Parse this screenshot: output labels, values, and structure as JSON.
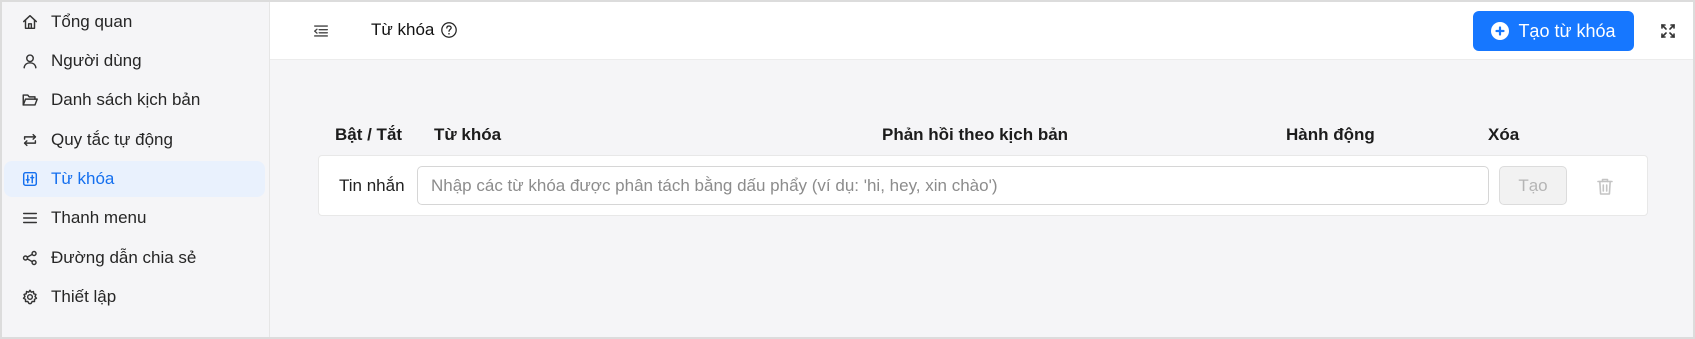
{
  "sidebar": {
    "items": [
      {
        "label": "Tổng quan",
        "icon": "home-icon",
        "active": false
      },
      {
        "label": "Người dùng",
        "icon": "user-icon",
        "active": false
      },
      {
        "label": "Danh sách kịch bản",
        "icon": "folder-open-icon",
        "active": false
      },
      {
        "label": "Quy tắc tự động",
        "icon": "repeat-icon",
        "active": false
      },
      {
        "label": "Từ khóa",
        "icon": "keyword-icon",
        "active": true
      },
      {
        "label": "Thanh menu",
        "icon": "menu-icon",
        "active": false
      },
      {
        "label": "Đường dẫn chia sẻ",
        "icon": "share-icon",
        "active": false
      },
      {
        "label": "Thiết lập",
        "icon": "gear-icon",
        "active": false
      }
    ]
  },
  "header": {
    "title": "Từ khóa",
    "collapse_icon": "menu-fold-icon",
    "help_icon": "question-circle-icon",
    "create_button": "Tạo từ khóa",
    "fullscreen_icon": "fullscreen-icon"
  },
  "table": {
    "columns": {
      "toggle": "Bật / Tắt",
      "keyword": "Từ khóa",
      "response": "Phản hồi theo kịch bản",
      "action": "Hành động",
      "delete": "Xóa"
    },
    "row": {
      "label": "Tin nhắn",
      "input_placeholder": "Nhập các từ khóa được phân tách bằng dấu phẩy (ví dụ: 'hi, hey, xin chào')",
      "input_value": "",
      "create_label": "Tạo",
      "create_disabled": true
    }
  },
  "colors": {
    "accent": "#1677ff",
    "active_bg": "#e9f1fd",
    "active_text": "#1570ef",
    "page_bg": "#f5f5f7"
  }
}
